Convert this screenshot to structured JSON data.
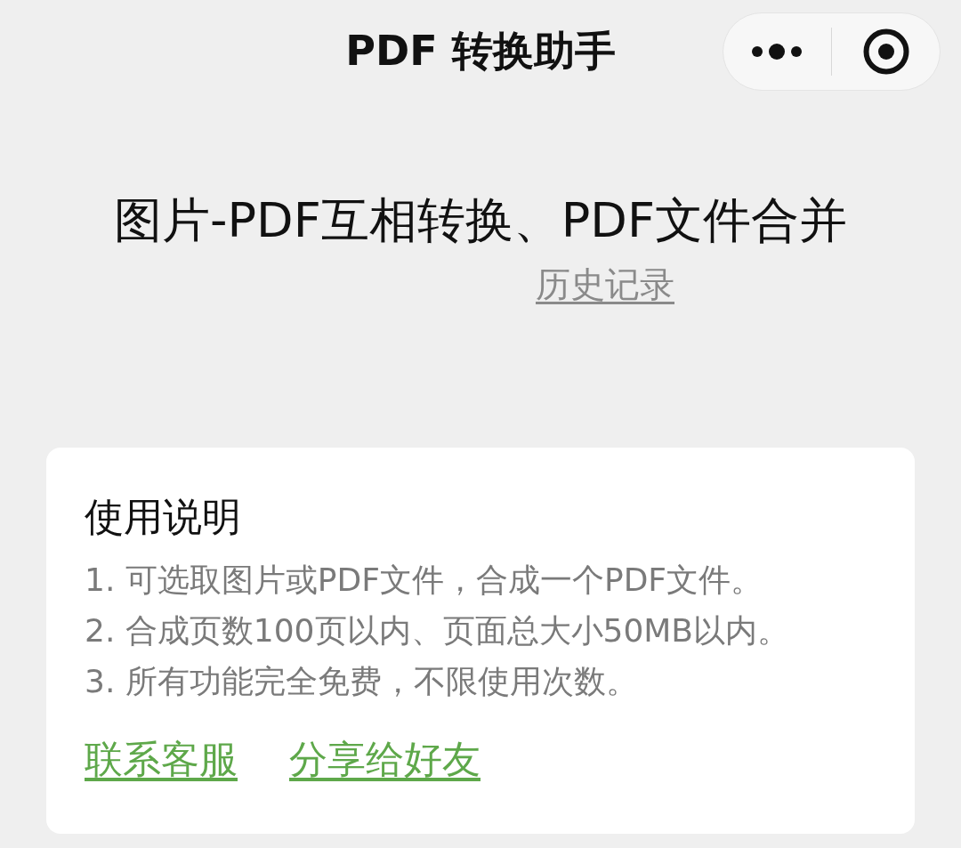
{
  "nav_bar": {
    "title": "PDF 转换助手"
  },
  "headline": "图片-PDF互相转换、PDF文件合并",
  "history_link": "历史记录",
  "instructions": {
    "title": "使用说明",
    "items": [
      "1. 可选取图片或PDF文件，合成一个PDF文件。",
      "2. 合成页数100页以内、页面总大小50MB以内。",
      "3. 所有功能完全免费，不限使用次数。"
    ],
    "links": [
      "联系客服",
      "分享给好友"
    ]
  }
}
